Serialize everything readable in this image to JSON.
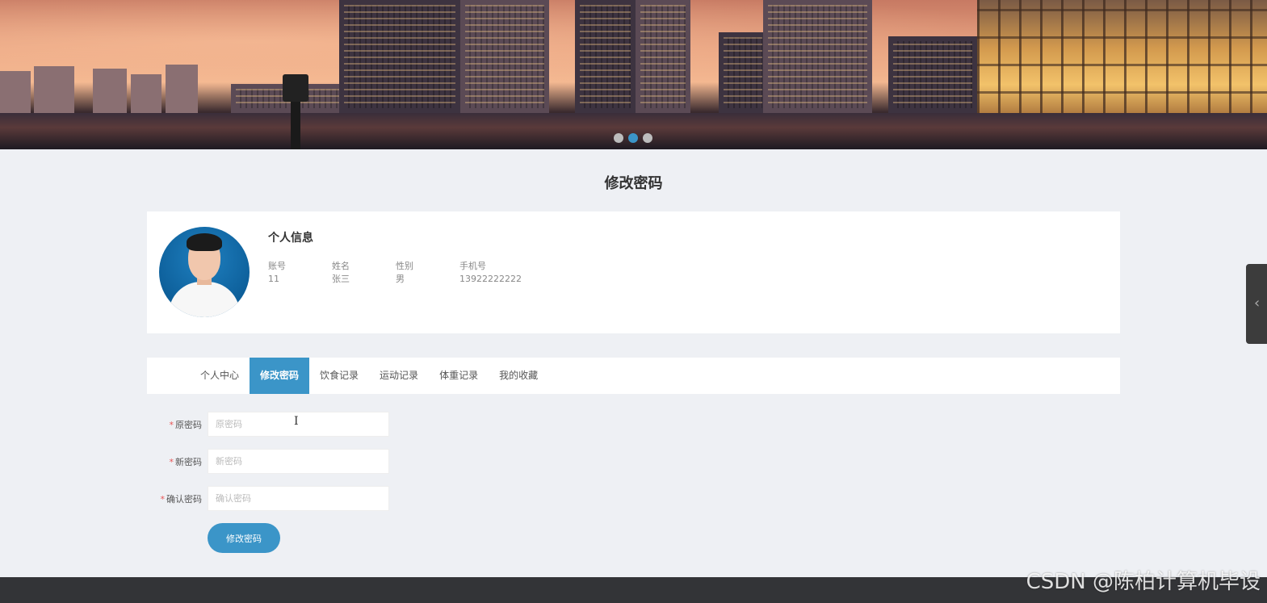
{
  "banner": {
    "carousel_count": 3,
    "carousel_active_index": 1
  },
  "page": {
    "title": "修改密码"
  },
  "profile": {
    "section_title": "个人信息",
    "fields": [
      {
        "label": "账号",
        "value": "11"
      },
      {
        "label": "姓名",
        "value": "张三"
      },
      {
        "label": "性别",
        "value": "男"
      },
      {
        "label": "手机号",
        "value": "13922222222"
      }
    ]
  },
  "tabs": [
    {
      "label": "个人中心",
      "active": false
    },
    {
      "label": "修改密码",
      "active": true
    },
    {
      "label": "饮食记录",
      "active": false
    },
    {
      "label": "运动记录",
      "active": false
    },
    {
      "label": "体重记录",
      "active": false
    },
    {
      "label": "我的收藏",
      "active": false
    }
  ],
  "form": {
    "required_mark": "*",
    "old_password": {
      "label": "原密码",
      "placeholder": "原密码",
      "value": ""
    },
    "new_password": {
      "label": "新密码",
      "placeholder": "新密码",
      "value": ""
    },
    "confirm_password": {
      "label": "确认密码",
      "placeholder": "确认密码",
      "value": ""
    },
    "submit_label": "修改密码"
  },
  "side_handle": {
    "icon": "chevron-left-icon",
    "glyph": "‹"
  },
  "footer": {
    "watermark": "CSDN @陈柏计算机毕设"
  },
  "colors": {
    "accent": "#3b95c8",
    "required": "#e85555",
    "footer": "#333437"
  }
}
